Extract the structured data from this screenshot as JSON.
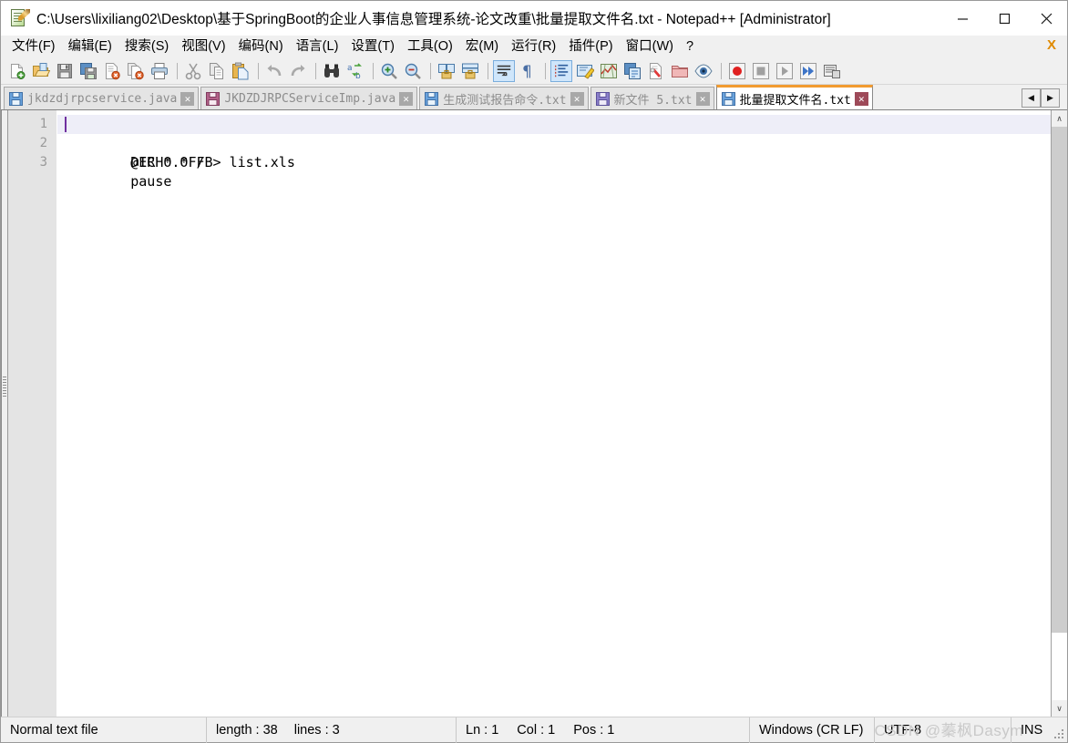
{
  "window": {
    "title": "C:\\Users\\lixiliang02\\Desktop\\基于SpringBoot的企业人事信息管理系统-论文改重\\批量提取文件名.txt - Notepad++ [Administrator]",
    "app_icon": "notepad-plus-plus-icon",
    "minimize_label": "─",
    "maximize_label": "□",
    "close_label": "✕"
  },
  "menubar": {
    "items": [
      {
        "label": "文件(F)",
        "name": "menu-file"
      },
      {
        "label": "编辑(E)",
        "name": "menu-edit"
      },
      {
        "label": "搜索(S)",
        "name": "menu-search"
      },
      {
        "label": "视图(V)",
        "name": "menu-view"
      },
      {
        "label": "编码(N)",
        "name": "menu-encoding"
      },
      {
        "label": "语言(L)",
        "name": "menu-language"
      },
      {
        "label": "设置(T)",
        "name": "menu-settings"
      },
      {
        "label": "工具(O)",
        "name": "menu-tools"
      },
      {
        "label": "宏(M)",
        "name": "menu-macro"
      },
      {
        "label": "运行(R)",
        "name": "menu-run"
      },
      {
        "label": "插件(P)",
        "name": "menu-plugins"
      },
      {
        "label": "窗口(W)",
        "name": "menu-window"
      },
      {
        "label": "?",
        "name": "menu-help"
      }
    ],
    "close_document_label": "X"
  },
  "toolbar": {
    "groups": [
      [
        "new-file-icon",
        "open-file-icon",
        "save-icon",
        "save-all-icon",
        "close-file-icon",
        "close-all-files-icon",
        "print-icon"
      ],
      [
        "cut-icon",
        "copy-icon",
        "paste-icon"
      ],
      [
        "undo-icon",
        "redo-icon"
      ],
      [
        "find-icon",
        "replace-icon"
      ],
      [
        "zoom-in-icon",
        "zoom-out-icon"
      ],
      [
        "sync-vertical-scroll-icon",
        "sync-horizontal-scroll-icon"
      ],
      [
        "word-wrap-icon",
        "show-all-characters-icon"
      ],
      [
        "indent-guide-icon",
        "user-defined-language-icon",
        "document-map-icon",
        "function-list-icon",
        "file-browser-icon",
        "folder-as-workspace-icon",
        "monitoring-icon"
      ],
      [
        "record-macro-icon",
        "stop-recording-icon",
        "playback-macro-icon",
        "run-macro-multiple-icon",
        "save-macro-icon"
      ]
    ],
    "active_toggles": [
      "word-wrap-icon",
      "indent-guide-icon"
    ]
  },
  "tabs": {
    "items": [
      {
        "label": "jkdzdjrpcservice.java",
        "icon": "saved-document-icon",
        "icon_color": "#4a86c8",
        "active": false,
        "close_label": "✕"
      },
      {
        "label": "JKDZDJRPCServiceImp.java",
        "icon": "unsaved-document-icon",
        "icon_color": "#b03a5b",
        "active": false,
        "close_label": "✕"
      },
      {
        "label": "生成测试报告命令.txt",
        "icon": "saved-document-icon",
        "icon_color": "#4a86c8",
        "active": false,
        "close_label": "✕"
      },
      {
        "label": "新文件 5.txt",
        "icon": "saved-document-icon",
        "icon_color": "#7b6fc0",
        "active": false,
        "close_label": "✕"
      },
      {
        "label": "批量提取文件名.txt",
        "icon": "saved-document-icon",
        "icon_color": "#4a86c8",
        "active": true,
        "close_label": "✕"
      }
    ],
    "scroll_left_label": "◀",
    "scroll_right_label": "▶"
  },
  "editor": {
    "line_numbers": [
      "1",
      "2",
      "3"
    ],
    "lines": [
      "@ECHO OFF",
      "DIR *.* /B> list.xls",
      "pause"
    ],
    "current_line": 1,
    "caret_color": "#7030a0",
    "current_line_bg": "#eeeef8",
    "scroll_up_label": "∧",
    "scroll_down_label": "∨"
  },
  "statusbar": {
    "file_type": "Normal text file",
    "length_label": "length : 38",
    "lines_label": "lines : 3",
    "ln": "Ln : 1",
    "col": "Col : 1",
    "pos": "Pos : 1",
    "eol": "Windows (CR LF)",
    "encoding": "UTF-8",
    "insert_mode": "INS"
  },
  "watermark": {
    "text": "CSDN @蓁枫Dasym"
  }
}
